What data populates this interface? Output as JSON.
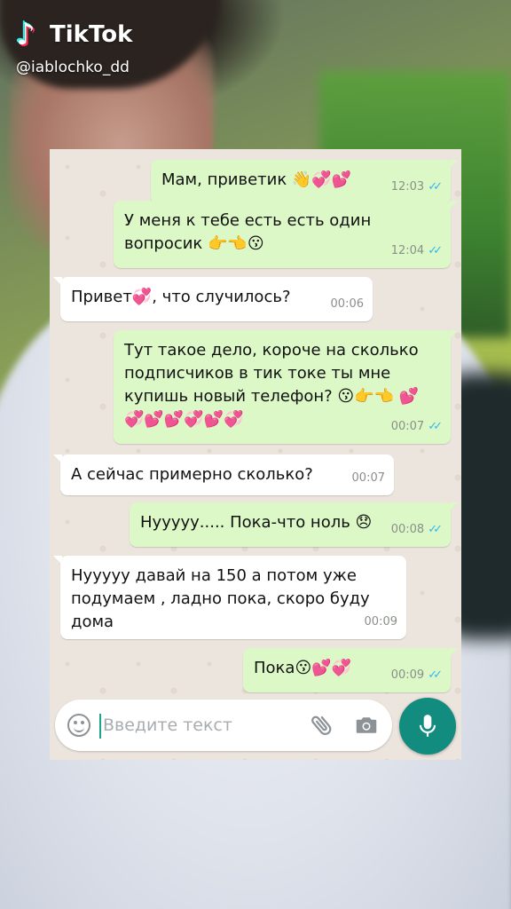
{
  "tiktok": {
    "logo_text": "TikTok",
    "username": "@iablochko_dd"
  },
  "chat": {
    "messages": [
      {
        "direction": "out",
        "text": "Мам, приветик 👋💞💕",
        "time": "12:03",
        "read": true
      },
      {
        "direction": "out",
        "text": "У меня к тебе есть есть один вопросик 👉👈😗",
        "time": "12:04",
        "read": true
      },
      {
        "direction": "in",
        "text": "Привет💞, что случилось?",
        "time": "00:06"
      },
      {
        "direction": "out",
        "text": "Тут такое дело, короче на сколько подписчиков в тик токе ты мне купишь новый телефон? 😗👉👈 💕💞💕💕💞💕💞",
        "time": "00:07",
        "read": true
      },
      {
        "direction": "in",
        "text": "А сейчас примерно сколько?",
        "time": "00:07"
      },
      {
        "direction": "out",
        "text": "Нууууу..... Пока-что ноль 😞",
        "time": "00:08",
        "read": true
      },
      {
        "direction": "in",
        "text": "Нууууу давай на 150 а потом уже подумаем , ладно пока, скоро буду дома",
        "time": "00:09"
      },
      {
        "direction": "out",
        "text": "Пока😗💕💞",
        "time": "00:09",
        "read": true
      }
    ]
  },
  "input": {
    "placeholder": "Введите текст"
  },
  "icons": {
    "emoji": "emoji-icon",
    "attach": "paperclip-icon",
    "camera": "camera-icon",
    "mic": "microphone-icon",
    "read_ticks": "double-check-icon"
  },
  "colors": {
    "outgoing_bubble": "#dcf8c6",
    "incoming_bubble": "#ffffff",
    "chat_bg": "#ece5dd",
    "accent": "#128c7e",
    "read_tick": "#34b7f1"
  }
}
